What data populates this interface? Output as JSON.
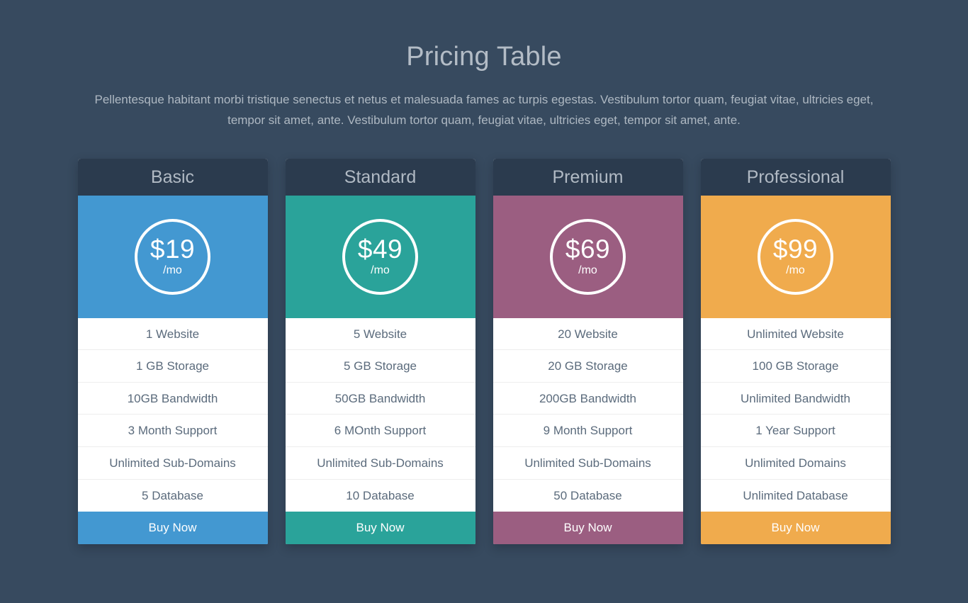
{
  "header": {
    "title": "Pricing Table",
    "description": "Pellentesque habitant morbi tristique senectus et netus et malesuada fames ac turpis egestas. Vestibulum tortor quam, feugiat vitae, ultricies eget, tempor sit amet, ante. Vestibulum tortor quam, feugiat vitae, ultricies eget, tempor sit amet, ante."
  },
  "theme": {
    "page_background": "#374a5f",
    "card_header_background": "#2b3b4e",
    "card_background": "#ffffff",
    "title_color": "#b3bcc6",
    "feature_text_color": "#5b6b7c",
    "divider_color": "#ededed"
  },
  "plans": [
    {
      "name": "Basic",
      "price": "$19",
      "period": "/mo",
      "accent": "#4398d1",
      "features": [
        "1 Website",
        "1 GB Storage",
        "10GB Bandwidth",
        "3 Month Support",
        "Unlimited Sub-Domains",
        "5 Database"
      ],
      "cta": "Buy Now"
    },
    {
      "name": "Standard",
      "price": "$49",
      "period": "/mo",
      "accent": "#2aa39a",
      "features": [
        "5 Website",
        "5 GB Storage",
        "50GB Bandwidth",
        "6 MOnth Support",
        "Unlimited Sub-Domains",
        "10 Database"
      ],
      "cta": "Buy Now"
    },
    {
      "name": "Premium",
      "price": "$69",
      "period": "/mo",
      "accent": "#9b5e81",
      "features": [
        "20 Website",
        "20 GB Storage",
        "200GB Bandwidth",
        "9 Month Support",
        "Unlimited Sub-Domains",
        "50 Database"
      ],
      "cta": "Buy Now"
    },
    {
      "name": "Professional",
      "price": "$99",
      "period": "/mo",
      "accent": "#f0ab4d",
      "features": [
        "Unlimited Website",
        "100 GB Storage",
        "Unlimited Bandwidth",
        "1 Year Support",
        "Unlimited Domains",
        "Unlimited Database"
      ],
      "cta": "Buy Now"
    }
  ]
}
